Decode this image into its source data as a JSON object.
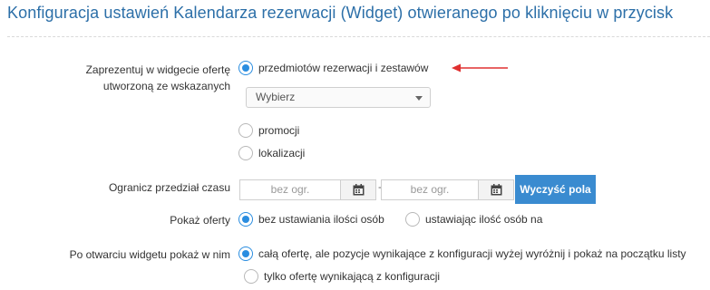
{
  "page": {
    "title": "Konfiguracja ustawień Kalendarza rezerwacji (Widget) otwieranego po kliknięciu w przycisk"
  },
  "offer_source": {
    "label_line1": "Zaprezentuj w widgecie ofertę",
    "label_line2": "utworzoną ze wskazanych",
    "options": [
      {
        "label": "przedmiotów rezerwacji i zestawów",
        "checked": true
      },
      {
        "label": "promocji",
        "checked": false
      },
      {
        "label": "lokalizacji",
        "checked": false
      }
    ],
    "select": {
      "value": "Wybierz"
    },
    "annotation_arrow_color": "#e03030"
  },
  "time_range": {
    "label": "Ogranicz przedział czasu",
    "from_placeholder": "bez ogr.",
    "to_placeholder": "bez ogr.",
    "separator": "-",
    "clear_button": "Wyczyść pola"
  },
  "show_offers": {
    "label": "Pokaż oferty",
    "options": [
      {
        "label": "bez ustawiania ilości osób",
        "checked": true
      },
      {
        "label": "ustawiając ilość osób na",
        "checked": false
      }
    ]
  },
  "after_open": {
    "label": "Po otwarciu widgetu pokaż w nim",
    "options": [
      {
        "label": "całą ofertę, ale pozycje wynikające z konfiguracji wyżej wyróżnij i pokaż na początku listy",
        "checked": true
      },
      {
        "label": "tylko ofertę wynikającą z konfiguracji",
        "checked": false
      }
    ]
  },
  "colors": {
    "accent": "#2a8de0",
    "title": "#2c6fa8",
    "button": "#3a8bd0"
  },
  "icons": {
    "calendar": "calendar-icon",
    "caret": "chevron-down-icon",
    "arrow": "red-arrow-icon"
  }
}
